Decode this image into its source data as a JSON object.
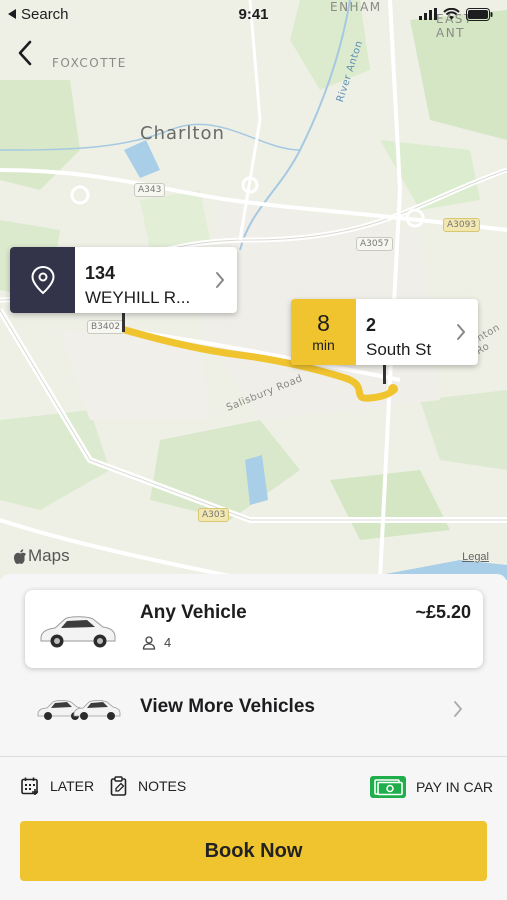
{
  "status_bar": {
    "back_app": "Search",
    "time": "9:41"
  },
  "map": {
    "labels": {
      "enham": "ENHAM",
      "east_ant": "EAST ANT",
      "foxcotte": "FOXCOTTE",
      "charlton": "Charlton",
      "river_anton": "River Anton",
      "salisbury_road": "Salisbury Road",
      "anton_rd": "Anton Ro"
    },
    "road_tags": {
      "a343": "A343",
      "a3057": "A3057",
      "a3093": "A3093",
      "b3402": "B3402",
      "a303": "A303"
    },
    "pickup": {
      "number": "134",
      "street": "WEYHILL R..."
    },
    "dropoff": {
      "eta_value": "8",
      "eta_unit": "min",
      "number": "2",
      "street": "South St"
    },
    "attribution": "Maps",
    "legal": "Legal"
  },
  "vehicle": {
    "name": "Any Vehicle",
    "price": "~£5.20",
    "seats": "4"
  },
  "more_vehicles": {
    "label": "View More Vehicles"
  },
  "options": {
    "later": "LATER",
    "notes": "NOTES",
    "pay": "PAY IN CAR"
  },
  "book_button": "Book Now",
  "colors": {
    "accent": "#f0c42e",
    "pin_dark": "#33334a",
    "route": "#f0c42e",
    "pay_green": "#1fae4b"
  }
}
